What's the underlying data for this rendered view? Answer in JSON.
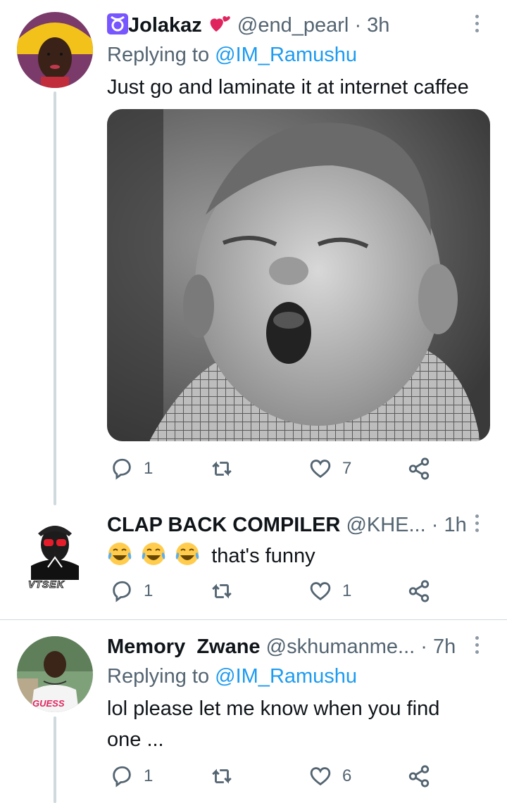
{
  "tweets": [
    {
      "display_name": "Jolakaz",
      "handle": "@end_pearl",
      "time": "3h",
      "replying_prefix": "Replying to",
      "replying_to": "@IM_Ramushu",
      "text": "Just go and laminate it at internet caffee",
      "replies": "1",
      "retweets": "",
      "likes": "7"
    },
    {
      "display_name": "CLAP BACK COMPILER",
      "handle": "@KHE...",
      "time": "1h",
      "text": "that's funny",
      "emojis": [
        "face-with-tears-of-joy",
        "face-with-tears-of-joy",
        "face-with-tears-of-joy"
      ],
      "avatar_caption": "VTSEK",
      "replies": "1",
      "retweets": "",
      "likes": "1"
    },
    {
      "display_name": "Memory  Zwane",
      "handle": "@skhumanme...",
      "time": "7h",
      "replying_prefix": "Replying to",
      "replying_to": "@IM_Ramushu",
      "text_line1": "lol please let me know when you find",
      "text_line2": "one ...",
      "avatar_shirt_text": "GUESS",
      "replies": "1",
      "retweets": "",
      "likes": "6"
    }
  ],
  "colors": {
    "link": "#1d9bf0",
    "muted": "#536471",
    "divider": "#cfd9de",
    "taurus_badge": "#7856ff",
    "heart_emoji": "#e0245e"
  },
  "icons": [
    "taurus-icon",
    "red-heart-icon",
    "reply-icon",
    "retweet-icon",
    "like-icon",
    "share-icon",
    "more-icon"
  ]
}
